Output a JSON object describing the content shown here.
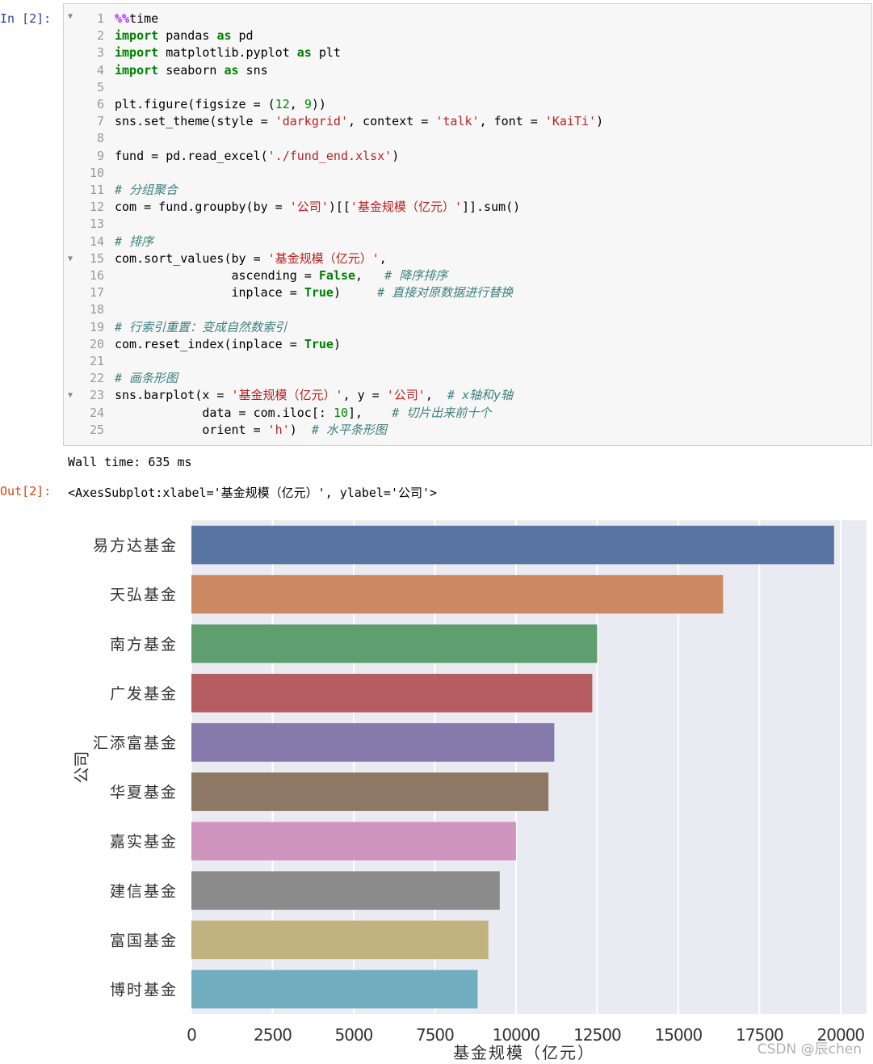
{
  "input_prompt": "In  [2]:",
  "output_prompt": "Out[2]:",
  "code_lines": [
    {
      "n": "1",
      "fold": false,
      "html": "<span class=\"mg\">%%</span>time"
    },
    {
      "n": "2",
      "fold": false,
      "html": "<span class=\"kw\">import</span> pandas <span class=\"kw\">as</span> pd"
    },
    {
      "n": "3",
      "fold": false,
      "html": "<span class=\"kw\">import</span> matplotlib.pyplot <span class=\"kw\">as</span> plt"
    },
    {
      "n": "4",
      "fold": false,
      "html": "<span class=\"kw\">import</span> seaborn <span class=\"kw\">as</span> sns"
    },
    {
      "n": "5",
      "fold": false,
      "html": ""
    },
    {
      "n": "6",
      "fold": false,
      "html": "plt.figure(figsize = (<span class=\"num\">12</span>, <span class=\"num\">9</span>))"
    },
    {
      "n": "7",
      "fold": false,
      "html": "sns.set_theme(style = <span class=\"str\">'darkgrid'</span>, context = <span class=\"str\">'talk'</span>, font = <span class=\"str\">'KaiTi'</span>)"
    },
    {
      "n": "8",
      "fold": false,
      "html": ""
    },
    {
      "n": "9",
      "fold": false,
      "html": "fund = pd.read_excel(<span class=\"str\">'./fund_end.xlsx'</span>)"
    },
    {
      "n": "10",
      "fold": false,
      "html": ""
    },
    {
      "n": "11",
      "fold": false,
      "html": "<span class=\"cm\"># 分组聚合</span>"
    },
    {
      "n": "12",
      "fold": false,
      "html": "com = fund.groupby(by = <span class=\"str\">'公司'</span>)[[<span class=\"str\">'基金规模（亿元）'</span>]].sum()"
    },
    {
      "n": "13",
      "fold": false,
      "html": ""
    },
    {
      "n": "14",
      "fold": false,
      "html": "<span class=\"cm\"># 排序</span>"
    },
    {
      "n": "15",
      "fold": true,
      "html": "com.sort_values(by = <span class=\"str\">'基金规模（亿元）'</span>,"
    },
    {
      "n": "16",
      "fold": false,
      "html": "                ascending = <span class=\"kwb\">False</span>,   <span class=\"cm\"># 降序排序</span>"
    },
    {
      "n": "17",
      "fold": false,
      "html": "                inplace = <span class=\"kwb\">True</span>)     <span class=\"cm\"># 直接对原数据进行替换</span>"
    },
    {
      "n": "18",
      "fold": false,
      "html": ""
    },
    {
      "n": "19",
      "fold": false,
      "html": "<span class=\"cm\"># 行索引重置：变成自然数索引</span>"
    },
    {
      "n": "20",
      "fold": false,
      "html": "com.reset_index(inplace = <span class=\"kwb\">True</span>)"
    },
    {
      "n": "21",
      "fold": false,
      "html": ""
    },
    {
      "n": "22",
      "fold": false,
      "html": "<span class=\"cm\"># 画条形图</span>"
    },
    {
      "n": "23",
      "fold": true,
      "html": "sns.barplot(x = <span class=\"str\">'基金规模（亿元）'</span>, y = <span class=\"str\">'公司'</span>,  <span class=\"cm\"># x轴和y轴</span>"
    },
    {
      "n": "24",
      "fold": false,
      "html": "            data = com.iloc[: <span class=\"num\">10</span>],    <span class=\"cm\"># 切片出来前十个</span>"
    },
    {
      "n": "25",
      "fold": false,
      "html": "            orient = <span class=\"str\">'h'</span>)  <span class=\"cm\"># 水平条形图</span>"
    }
  ],
  "stdout": "Wall time: 635 ms",
  "repr_output": "<AxesSubplot:xlabel='基金规模（亿元）', ylabel='公司'>",
  "watermark": "CSDN @辰chen",
  "colors": {
    "axes_bg": "#eaeaf2",
    "grid": "#ffffff",
    "tick_text": "#333333"
  },
  "chart_data": {
    "type": "bar",
    "orientation": "horizontal",
    "categories": [
      "易方达基金",
      "天弘基金",
      "南方基金",
      "广发基金",
      "汇添富基金",
      "华夏基金",
      "嘉实基金",
      "建信基金",
      "富国基金",
      "博时基金"
    ],
    "values": [
      19800,
      16380,
      12500,
      12350,
      11180,
      11000,
      10000,
      9500,
      9150,
      8820
    ],
    "colors": [
      "#5875a4",
      "#cc8963",
      "#5f9e6e",
      "#b55d60",
      "#857aab",
      "#8d7866",
      "#d095bf",
      "#8c8c8c",
      "#c1b37f",
      "#71aec0"
    ],
    "xlabel": "基金规模（亿元）",
    "ylabel": "公司",
    "xlim": [
      0,
      20800
    ],
    "xticks": [
      0,
      2500,
      5000,
      7500,
      10000,
      12500,
      15000,
      17500,
      20000
    ],
    "xtick_labels": [
      "0",
      "2500",
      "5000",
      "7500",
      "10000",
      "12500",
      "15000",
      "17500",
      "20000"
    ],
    "grid": true
  }
}
